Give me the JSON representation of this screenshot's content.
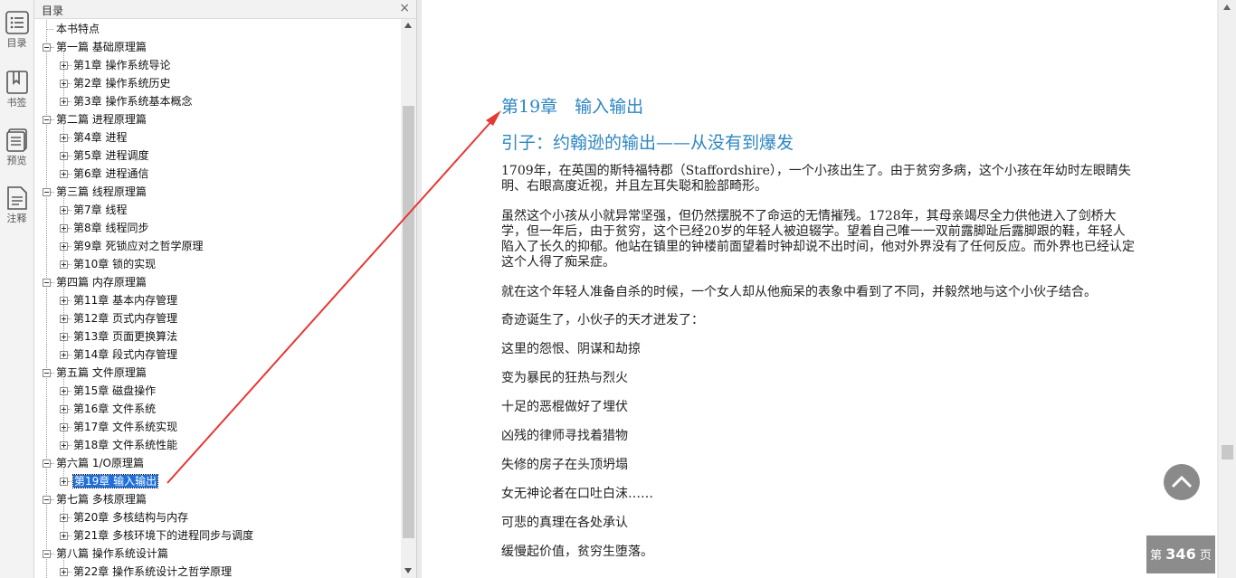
{
  "rail": {
    "items": [
      {
        "label": "目录",
        "icon": "list-icon"
      },
      {
        "label": "书签",
        "icon": "bookmark-icon"
      },
      {
        "label": "预览",
        "icon": "preview-icon"
      },
      {
        "label": "注释",
        "icon": "note-icon"
      }
    ]
  },
  "toc": {
    "title": "目录",
    "close": "×",
    "items": [
      {
        "label": "本书特点",
        "level": 0,
        "box": "none"
      },
      {
        "label": "第一篇 基础原理篇",
        "level": 0,
        "box": "minus"
      },
      {
        "label": "第1章 操作系统导论",
        "level": 1,
        "box": "plus"
      },
      {
        "label": "第2章 操作系统历史",
        "level": 1,
        "box": "plus"
      },
      {
        "label": "第3章 操作系统基本概念",
        "level": 1,
        "box": "plus"
      },
      {
        "label": "第二篇 进程原理篇",
        "level": 0,
        "box": "minus"
      },
      {
        "label": "第4章 进程",
        "level": 1,
        "box": "plus"
      },
      {
        "label": "第5章 进程调度",
        "level": 1,
        "box": "plus"
      },
      {
        "label": "第6章 进程通信",
        "level": 1,
        "box": "plus"
      },
      {
        "label": "第三篇 线程原理篇",
        "level": 0,
        "box": "minus"
      },
      {
        "label": "第7章 线程",
        "level": 1,
        "box": "plus"
      },
      {
        "label": "第8章 线程同步",
        "level": 1,
        "box": "plus"
      },
      {
        "label": "第9章 死锁应对之哲学原理",
        "level": 1,
        "box": "plus"
      },
      {
        "label": "第10章 锁的实现",
        "level": 1,
        "box": "plus"
      },
      {
        "label": "第四篇 内存原理篇",
        "level": 0,
        "box": "minus"
      },
      {
        "label": "第11章 基本内存管理",
        "level": 1,
        "box": "plus"
      },
      {
        "label": "第12章 页式内存管理",
        "level": 1,
        "box": "plus"
      },
      {
        "label": "第13章 页面更换算法",
        "level": 1,
        "box": "plus"
      },
      {
        "label": "第14章 段式内存管理",
        "level": 1,
        "box": "plus"
      },
      {
        "label": "第五篇 文件原理篇",
        "level": 0,
        "box": "minus"
      },
      {
        "label": "第15章 磁盘操作",
        "level": 1,
        "box": "plus"
      },
      {
        "label": "第16章 文件系统",
        "level": 1,
        "box": "plus"
      },
      {
        "label": "第17章 文件系统实现",
        "level": 1,
        "box": "plus"
      },
      {
        "label": "第18章 文件系统性能",
        "level": 1,
        "box": "plus"
      },
      {
        "label": "第六篇 1/O原理篇",
        "level": 0,
        "box": "minus"
      },
      {
        "label": "第19章 输入输出",
        "level": 1,
        "box": "plus",
        "selected": true
      },
      {
        "label": "第七篇 多核原理篇",
        "level": 0,
        "box": "minus"
      },
      {
        "label": "第20章 多核结构与内存",
        "level": 1,
        "box": "plus"
      },
      {
        "label": "第21章 多核环境下的进程同步与调度",
        "level": 1,
        "box": "plus"
      },
      {
        "label": "第八篇 操作系统设计篇",
        "level": 0,
        "box": "minus"
      },
      {
        "label": "第22章 操作系统设计之哲学原理",
        "level": 1,
        "box": "plus"
      }
    ]
  },
  "doc": {
    "chapter_title": "第19章　输入输出",
    "section_title": "引子：约翰逊的输出——从没有到爆发",
    "paragraphs": [
      "1709年，在英国的斯特福特郡（Staffordshire），一个小孩出生了。由于贫穷多病，这个小孩在年幼时左眼睛失明、右眼高度近视，并且左耳失聪和脸部畸形。",
      "虽然这个小孩从小就异常坚强，但仍然摆脱不了命运的无情摧残。1728年，其母亲竭尽全力供他进入了剑桥大学，但一年后，由于贫穷，这个已经20岁的年轻人被迫辍学。望着自己唯一一双前露脚趾后露脚跟的鞋，年轻人陷入了长久的抑郁。他站在镇里的钟楼前面望着时钟却说不出时间，他对外界没有了任何反应。而外界也已经认定这个人得了痴呆症。",
      "就在这个年轻人准备自杀的时候，一个女人却从他痴呆的表象中看到了不同，并毅然地与这个小伙子结合。",
      "奇迹诞生了，小伙子的天才迸发了：",
      "这里的怨恨、阴谋和劫掠",
      "变为暴民的狂热与烈火",
      "十足的恶棍做好了埋伏",
      "凶残的律师寻找着猎物",
      "失修的房子在头顶坍塌",
      "女无神论者在口吐白沫……",
      "可悲的真理在各处承认",
      "缓慢起价值，贫穷生堕落。"
    ]
  },
  "page_indicator": {
    "prefix": "第",
    "number": "346",
    "suffix": "页"
  },
  "colors": {
    "heading": "#2e86c1",
    "selection": "#1e6fd9",
    "annotation_arrow": "#e53935"
  }
}
